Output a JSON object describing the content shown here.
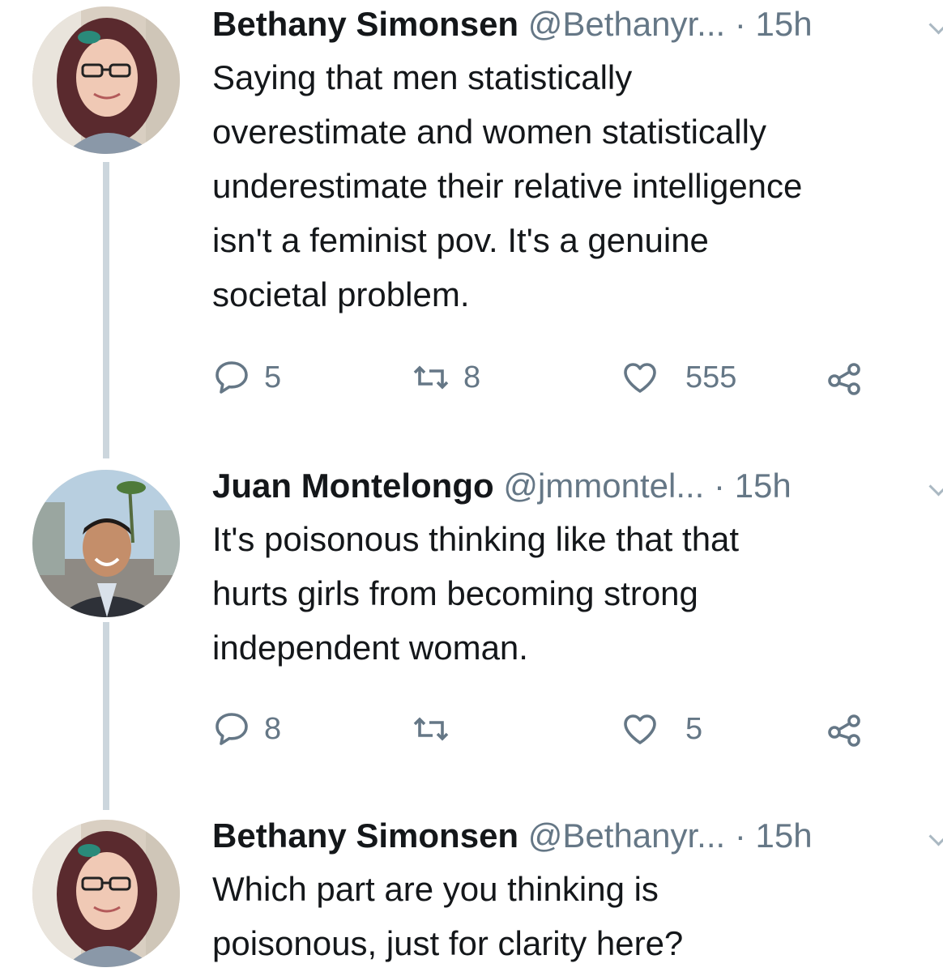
{
  "tweets": [
    {
      "name": "Bethany Simonsen",
      "handle": "@Bethanyr...",
      "separator": "·",
      "time": "15h",
      "text": "Saying that men statistically\noverestimate and women statistically\nunderestimate their relative intelligence\nisn't a feminist pov. It's a genuine\nsocietal problem.",
      "replies": "5",
      "retweets": "8",
      "likes": "555"
    },
    {
      "name": "Juan Montelongo",
      "handle": "@jmmontel...",
      "separator": "·",
      "time": "15h",
      "text": "It's poisonous thinking like that that\nhurts girls from becoming strong\nindependent woman.",
      "replies": "8",
      "retweets": "",
      "likes": "5"
    },
    {
      "name": "Bethany Simonsen",
      "handle": "@Bethanyr...",
      "separator": "·",
      "time": "15h",
      "text": "Which part are you thinking is\npoisonous, just for clarity here?"
    }
  ],
  "icons": {
    "reply": "reply-icon",
    "retweet": "retweet-icon",
    "like": "heart-icon",
    "share": "share-icon",
    "more": "chevron-down-icon"
  },
  "colors": {
    "text": "#14171a",
    "secondary": "#657786",
    "thread_line": "#ccd6dd"
  }
}
